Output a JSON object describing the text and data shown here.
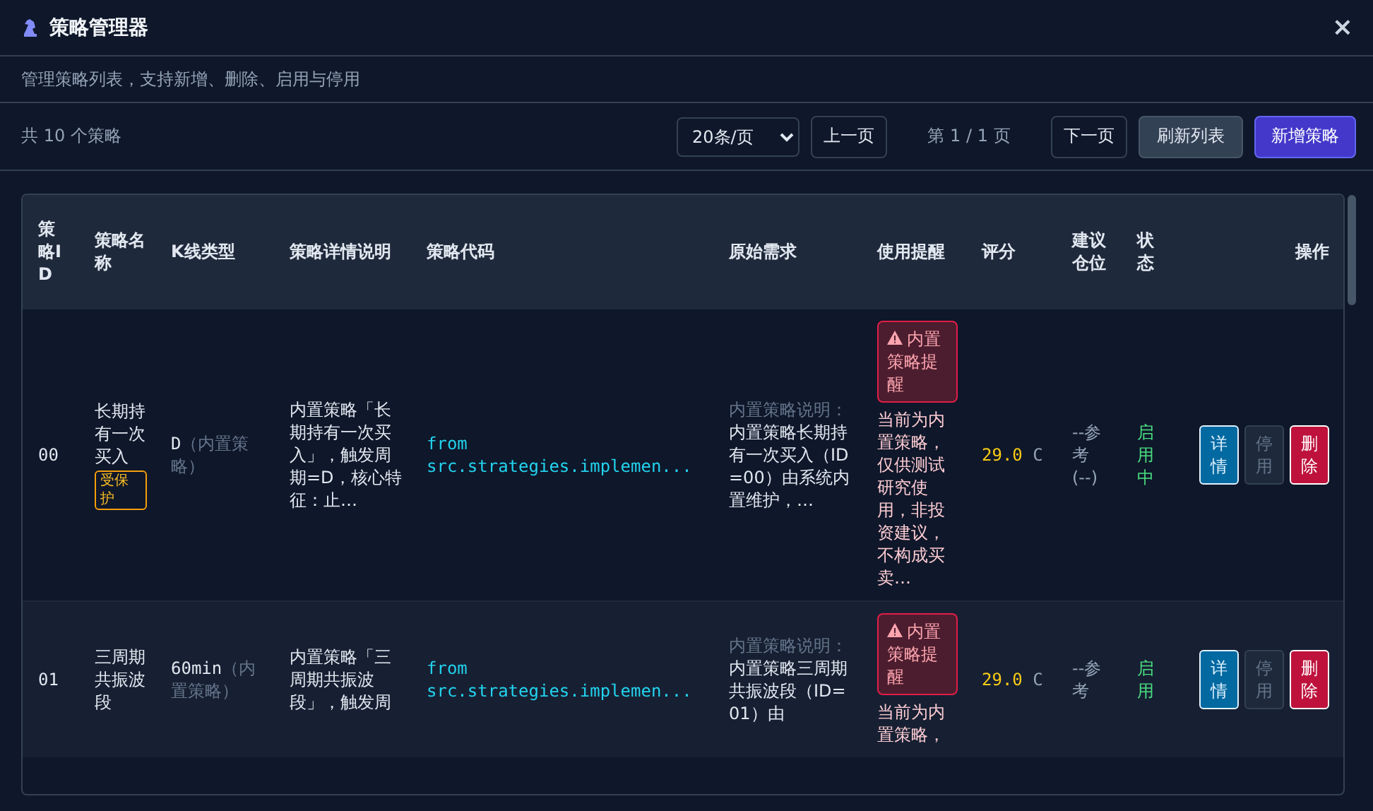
{
  "window": {
    "title": "策略管理器",
    "close": "×"
  },
  "subtitle": "管理策略列表，支持新增、删除、启用与停用",
  "toolbar": {
    "count": "共 10 个策略",
    "page_size": "20条/页",
    "prev": "上一页",
    "page_info": "第 1 / 1 页",
    "next": "下一页",
    "refresh": "刷新列表",
    "add": "新增策略"
  },
  "table": {
    "columns": [
      "策略ID",
      "策略名称",
      "K线类型",
      "策略详情说明",
      "策略代码",
      "原始需求",
      "使用提醒",
      "评分",
      "建议仓位",
      "状态",
      "操作"
    ],
    "rows": [
      {
        "id": "00",
        "name": "长期持有一次买入",
        "protected": true,
        "protected_label": "受保护",
        "kline": "D",
        "kline_note": "（内置策略）",
        "description": "内置策略「长期持有一次买入」，触发周期=D，核心特征：止…",
        "code": "from src.strategies.implemen...",
        "requirement_label": "内置策略说明：",
        "requirement": "内置策略长期持有一次买入（ID=00）由系统内置维护，…",
        "reminder_badge": "内置策略提醒",
        "reminder": "当前为内置策略，仅供测试研究使用，非投资建议，不构成买卖…",
        "score": "29.0",
        "grade": "C",
        "position": "--参考",
        "position_note": "(--)",
        "status": "启用中",
        "enabled": true,
        "actions": [
          {
            "label": "详情",
            "kind": "info",
            "disabled": false
          },
          {
            "label": "停用",
            "kind": "toggle",
            "disabled": true
          },
          {
            "label": "删除",
            "kind": "danger",
            "disabled": false
          }
        ]
      },
      {
        "id": "01",
        "name": "三周期共振波段",
        "protected": false,
        "kline": "60min",
        "kline_note": "（内置策略）",
        "description": "内置策略「三周期共振波段」，触发周",
        "code": "from src.strategies.implemen...",
        "requirement_label": "内置策略说明：",
        "requirement": "内置策略三周期共振波段（ID=01）由",
        "reminder_badge": "内置策略提醒",
        "reminder": "当前为内置策略，",
        "score": "29.0",
        "grade": "C",
        "position": "--参考",
        "status": "启用",
        "enabled": true,
        "actions": [
          {
            "label": "详情",
            "kind": "info",
            "disabled": false
          },
          {
            "label": "停用",
            "kind": "toggle",
            "disabled": true
          },
          {
            "label": "删除",
            "kind": "danger",
            "disabled": false
          }
        ]
      }
    ]
  }
}
